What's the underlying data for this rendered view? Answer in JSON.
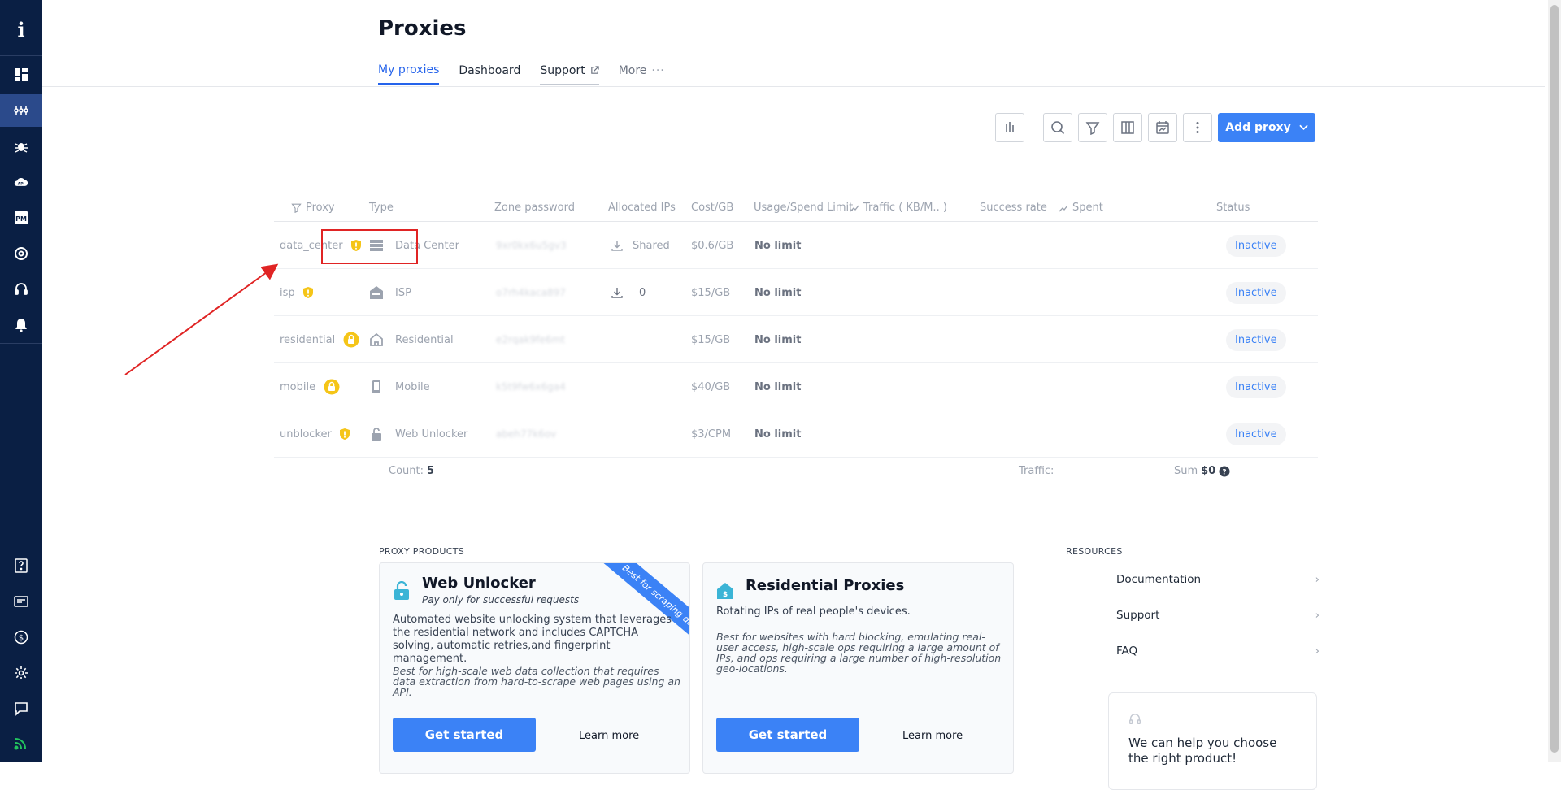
{
  "sidebar": {
    "logo": "i",
    "icons": [
      "dashboard-icon",
      "proxies-icon",
      "scraper-icon",
      "api-icon",
      "proxy-manager-icon",
      "browser-icon",
      "support-icon",
      "notifications-icon"
    ],
    "bottom_icons": [
      "help-icon",
      "billing-icon",
      "dollar-icon",
      "settings-icon",
      "chat-icon",
      "feed-icon"
    ],
    "proxy_manager_label": "PM",
    "api_label": "API"
  },
  "header": {
    "title": "Proxies",
    "tabs": [
      {
        "label": "My proxies",
        "active": true
      },
      {
        "label": "Dashboard",
        "active": false
      },
      {
        "label": "Support",
        "active": false,
        "external": true
      },
      {
        "label": "More",
        "active": false
      }
    ]
  },
  "toolbar": {
    "add_proxy_label": "Add proxy",
    "icons": [
      "bar-chart-icon",
      "search-icon",
      "filter-icon",
      "columns-icon",
      "calendar-chart-icon",
      "more-vertical-icon"
    ]
  },
  "table": {
    "columns": [
      "Proxy",
      "Type",
      "Zone password",
      "Allocated IPs",
      "Cost/GB",
      "Usage/Spend Limit",
      "Traffic ( KB/M.. )",
      "Success rate",
      "Spent",
      "Status"
    ],
    "rows": [
      {
        "proxy": "data_center",
        "badge": "warning",
        "type_icon": "server-icon",
        "type": "Data Center",
        "password": "9xr0kx6u5gv3",
        "ips": "Shared",
        "cost": "$0.6/GB",
        "limit": "No limit",
        "status": "Inactive"
      },
      {
        "proxy": "isp",
        "badge": "warning",
        "type_icon": "house-icon",
        "type": "ISP",
        "password": "o7rh4kaca897",
        "ips": "0",
        "cost": "$15/GB",
        "limit": "No limit",
        "status": "Inactive"
      },
      {
        "proxy": "residential",
        "badge": "lock",
        "type_icon": "home-icon",
        "type": "Residential",
        "password": "e2rqak9fe6mt",
        "ips": "",
        "cost": "$15/GB",
        "limit": "No limit",
        "status": "Inactive"
      },
      {
        "proxy": "mobile",
        "badge": "lock",
        "type_icon": "phone-icon",
        "type": "Mobile",
        "password": "k5t9fw6x6ga4",
        "ips": "",
        "cost": "$40/GB",
        "limit": "No limit",
        "status": "Inactive"
      },
      {
        "proxy": "unblocker",
        "badge": "warning",
        "type_icon": "unlock-icon",
        "type": "Web Unlocker",
        "password": "abeh77k6ov",
        "ips": "",
        "cost": "$3/CPM",
        "limit": "No limit",
        "status": "Inactive"
      }
    ],
    "footer": {
      "count_label": "Count:",
      "count": "5",
      "traffic_label": "Traffic:",
      "sum_label": "Sum",
      "sum": "$0"
    }
  },
  "products": {
    "section_label": "PROXY PRODUCTS",
    "cards": [
      {
        "title": "Web Unlocker",
        "subtitle": "Pay only for successful requests",
        "ribbon": "Best for scraping data",
        "description": "Automated website unlocking system that leverages the residential network and includes CAPTCHA solving, automatic retries,and fingerprint management.",
        "note": "Best for high-scale web data collection that requires data extraction from hard-to-scrape web pages using an API.",
        "cta": "Get started",
        "link": "Learn more"
      },
      {
        "title": "Residential Proxies",
        "description": "Rotating IPs of real people's devices.",
        "note": "Best for websites with hard blocking, emulating real-user access, high-scale ops requiring a large amount of IPs, and ops requiring a large number of high-resolution geo-locations.",
        "cta": "Get started",
        "link": "Learn more"
      }
    ]
  },
  "resources": {
    "section_label": "RESOURCES",
    "items": [
      "Documentation",
      "Support",
      "FAQ"
    ],
    "help_text": "We can help you choose the right product!"
  },
  "colors": {
    "sidebar": "#0a1f44",
    "accent": "#3b82f6",
    "warning": "#f5c518",
    "annotation": "#e02424"
  }
}
